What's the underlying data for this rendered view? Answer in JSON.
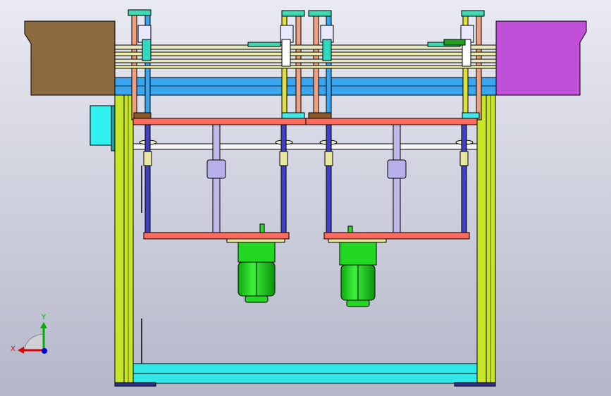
{
  "viewport": {
    "background_top": "#e9eaf2",
    "background_bottom": "#b4b7c9"
  },
  "triad": {
    "x_label": "X",
    "y_label": "Y",
    "x_color": "#e00000",
    "y_color": "#00b000",
    "z_color": "#0000e0"
  },
  "colors": {
    "left_conveyor": "#8b6a40",
    "right_conveyor": "#c050d8",
    "frame_green": "#c8e628",
    "frame_blue": "#3aa6f0",
    "plate_red": "#ff6a5c",
    "motor_green": "#22d822",
    "cyan_box": "#30f0f0"
  }
}
